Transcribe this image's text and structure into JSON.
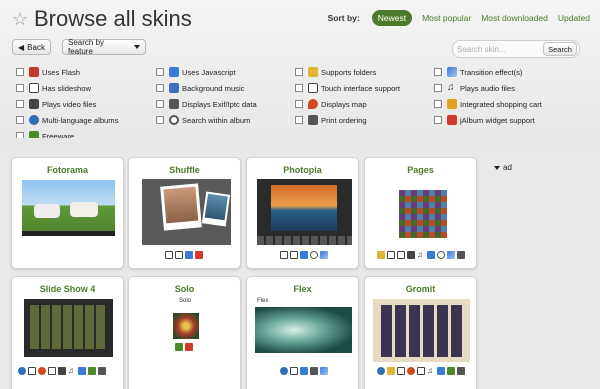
{
  "header": {
    "title": "Browse all skins"
  },
  "sort": {
    "label": "Sort by:",
    "options": [
      "Newest",
      "Most popular",
      "Most downloaded",
      "Updated"
    ],
    "active": "Newest"
  },
  "toolbar": {
    "back_label": "Back",
    "feature_label": "Search by feature"
  },
  "search": {
    "placeholder": "Search skin...",
    "button_label": "Search"
  },
  "features": [
    {
      "label": "Uses Flash",
      "icon": "flash-icon",
      "color": "#c0392b"
    },
    {
      "label": "Has slideshow",
      "icon": "slideshow-icon",
      "color": "#444444"
    },
    {
      "label": "Plays video files",
      "icon": "video-icon",
      "color": "#444444"
    },
    {
      "label": "Multi-language albums",
      "icon": "globe-icon",
      "color": "#2e6fb8"
    },
    {
      "label": "Freeware",
      "icon": "freeware-icon",
      "color": "#4c8a2a"
    },
    {
      "label": "Uses Javascript",
      "icon": "javascript-icon",
      "color": "#3b7bd6"
    },
    {
      "label": "Background music",
      "icon": "music-icon",
      "color": "#3a6fc2"
    },
    {
      "label": "Displays Exif/Iptc data",
      "icon": "camera-icon",
      "color": "#555555"
    },
    {
      "label": "Search within album",
      "icon": "search-icon",
      "color": "#555555"
    },
    {
      "label": "Supports folders",
      "icon": "folder-icon",
      "color": "#e0b437"
    },
    {
      "label": "Touch interface support",
      "icon": "touch-icon",
      "color": "#444444"
    },
    {
      "label": "Displays map",
      "icon": "map-pin-icon",
      "color": "#d24a1b"
    },
    {
      "label": "Print ordering",
      "icon": "print-icon",
      "color": "#555555"
    },
    {
      "label": "Transition effect(s)",
      "icon": "transition-icon",
      "color": "#3b7bd6"
    },
    {
      "label": "Plays audio files",
      "icon": "audio-icon",
      "color": "#333333"
    },
    {
      "label": "Integrated shopping cart",
      "icon": "cart-icon",
      "color": "#e0a21d"
    },
    {
      "label": "jAlbum widget support",
      "icon": "widget-icon",
      "color": "#d23a2a"
    }
  ],
  "skins": [
    {
      "name": "Fotorama",
      "preview": "cows-photo"
    },
    {
      "name": "Shuffle",
      "preview": "child-portrait"
    },
    {
      "name": "Photopia",
      "preview": "sunset-gallery"
    },
    {
      "name": "Pages",
      "preview": "photo-grid"
    },
    {
      "name": "Slide Show 4",
      "preview": "dark-grid"
    },
    {
      "name": "Solo",
      "preview": "flower-photo",
      "inner_title": "Solo"
    },
    {
      "name": "Flex",
      "preview": "fern-photo",
      "inner_title": "Flex"
    },
    {
      "name": "Gromit",
      "preview": "nebula-grid"
    }
  ],
  "ad": {
    "label": "ad"
  },
  "colors": {
    "accent": "#4c7a2a",
    "background": "#e9e9e9"
  }
}
